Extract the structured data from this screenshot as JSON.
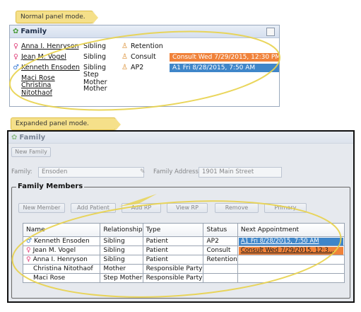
{
  "colors": {
    "callout_bg": "#f5e08a",
    "highlight_ellipse": "#e8d24a",
    "appt_orange": "#f0823a",
    "appt_blue": "#3f86c9",
    "female_icon": "#e0407a",
    "male_icon": "#3a7bd5"
  },
  "normal": {
    "callout": "Normal panel mode.",
    "panel_title": "Family",
    "members": [
      {
        "name": "Anna I. Henryson",
        "gender": "female",
        "relationship": "Sibling",
        "type": "Retention",
        "appointment": "",
        "appt_color": ""
      },
      {
        "name": "Jean M. Vogel",
        "gender": "female",
        "relationship": "Sibling",
        "type": "Consult",
        "appointment": "Consult   Wed 7/29/2015, 12:30 PM",
        "appt_color": "orange"
      },
      {
        "name": "Kenneth Ensoden",
        "gender": "male",
        "relationship": "Sibling",
        "type": "AP2",
        "appointment": "A1   Fri 8/28/2015, 7:50 AM",
        "appt_color": "blue"
      },
      {
        "name": "Maci Rose",
        "gender": "",
        "relationship": "Step Mother",
        "type": "",
        "appointment": "",
        "appt_color": ""
      },
      {
        "name": "Christina Nitothaof",
        "gender": "",
        "relationship": "Mother",
        "type": "",
        "appointment": "",
        "appt_color": ""
      }
    ]
  },
  "expanded": {
    "callout": "Expanded panel mode.",
    "panel_title": "Family",
    "new_family_button": "New Family",
    "family_label": "Family:",
    "family_value": "Ensoden",
    "address_label": "Family Address:",
    "address_value": "1901 Main Street",
    "members_title": "Family Members",
    "toolbar_buttons": [
      "New Member",
      "Add Patient",
      "Add RP",
      "View RP",
      "Remove",
      "Primary"
    ],
    "columns": [
      "Name",
      "Relationship",
      "Type",
      "Status",
      "Next Appointment"
    ],
    "rows": [
      {
        "name": "Kenneth Ensoden",
        "gender": "male",
        "relationship": "Sibling",
        "type": "Patient",
        "status": "AP2",
        "appointment": "A1   Fri 8/28/2015, 7:50 AM",
        "appt_color": "blue"
      },
      {
        "name": "Jean M. Vogel",
        "gender": "female",
        "relationship": "Sibling",
        "type": "Patient",
        "status": "Consult",
        "appointment": "Consult   Wed 7/29/2015, 12:3...",
        "appt_color": "orange"
      },
      {
        "name": "Anna I. Henryson",
        "gender": "female",
        "relationship": "Sibling",
        "type": "Patient",
        "status": "Retention",
        "appointment": "",
        "appt_color": ""
      },
      {
        "name": "Christina Nitothaof",
        "gender": "",
        "relationship": "Mother",
        "type": "Responsible Party",
        "status": "",
        "appointment": "",
        "appt_color": ""
      },
      {
        "name": "Maci Rose",
        "gender": "",
        "relationship": "Step Mother",
        "type": "Responsible Party",
        "status": "",
        "appointment": "",
        "appt_color": ""
      }
    ]
  }
}
